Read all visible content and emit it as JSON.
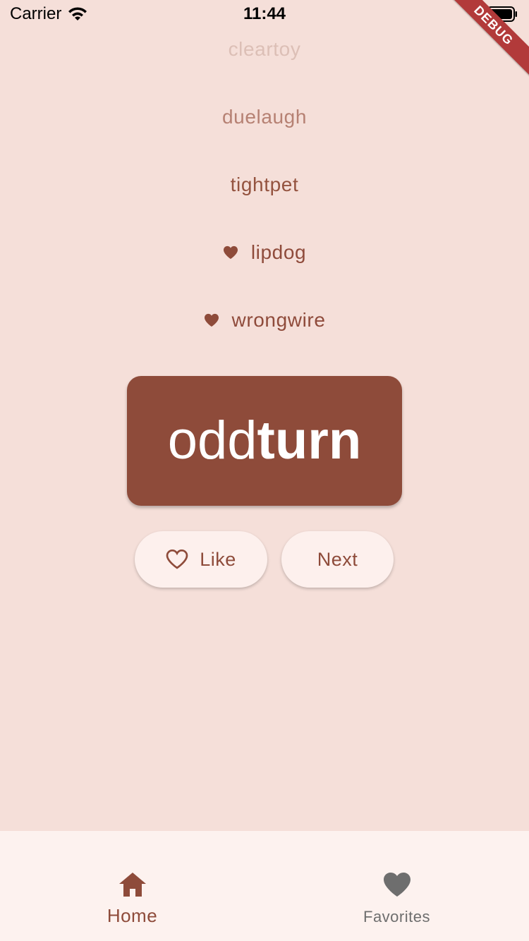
{
  "status_bar": {
    "carrier": "Carrier",
    "time": "11:44",
    "wifi_icon": "wifi-icon",
    "battery_icon": "battery-icon"
  },
  "debug_banner": "DEBUG",
  "history": [
    {
      "word": "cleartoy",
      "favorite": false
    },
    {
      "word": "duelaugh",
      "favorite": false
    },
    {
      "word": "tightpet",
      "favorite": false
    },
    {
      "word": "lipdog",
      "favorite": true
    },
    {
      "word": "wrongwire",
      "favorite": true
    }
  ],
  "current_pair": {
    "first": "odd",
    "second": "turn"
  },
  "actions": {
    "like_label": "Like",
    "like_icon": "heart-outline-icon",
    "next_label": "Next"
  },
  "navigation": {
    "home_label": "Home",
    "home_icon": "home-icon",
    "favorites_label": "Favorites",
    "favorites_icon": "heart-icon"
  },
  "colors": {
    "background": "#f5dfd9",
    "primary": "#8e4b3a",
    "surface": "#fdf0ed",
    "debug": "#b23a3a"
  }
}
